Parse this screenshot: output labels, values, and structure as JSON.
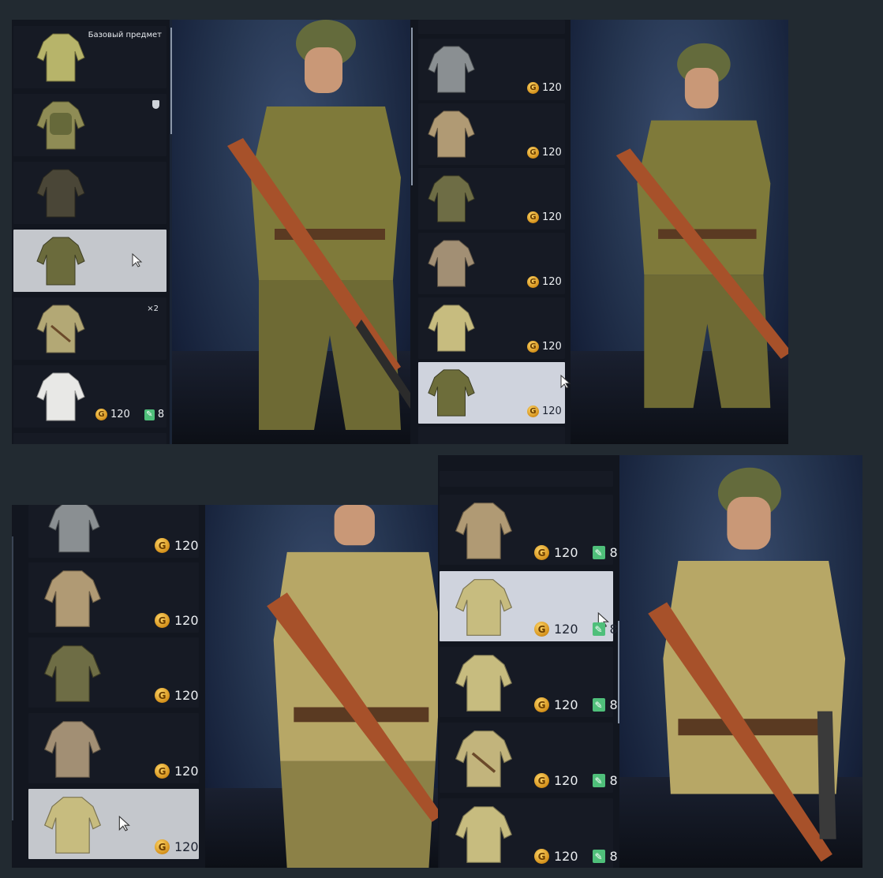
{
  "colors": {
    "jacket_base": "#b7b46a",
    "jacket_olive": "#7a7a3c",
    "jacket_grey": "#8a8f92",
    "jacket_tan": "#b09a74",
    "jacket_white": "#e8e8e6",
    "jacket_khaki": "#c7bc7f",
    "coin": "#e1a326",
    "selected_bg": "#cfd3dd"
  },
  "panel1": {
    "items": [
      {
        "label": "Базовый предмет",
        "jacket": "jacket_base",
        "badge": ""
      },
      {
        "label": "",
        "jacket": "jacket_olive",
        "badge": "shield-icon"
      },
      {
        "label": "",
        "jacket": "jacket_olive",
        "badge": ""
      },
      {
        "label": "",
        "jacket": "jacket_olive",
        "badge": "",
        "selected": true
      },
      {
        "label": "×2",
        "jacket": "jacket_khaki",
        "badge": ""
      },
      {
        "label": "",
        "jacket": "jacket_white",
        "badge": "",
        "price": "120",
        "tickets": "8"
      }
    ]
  },
  "panel2": {
    "items": [
      {
        "jacket": "jacket_grey",
        "price": "120"
      },
      {
        "jacket": "jacket_tan",
        "price": "120"
      },
      {
        "jacket": "jacket_olive",
        "price": "120"
      },
      {
        "jacket": "jacket_tan",
        "price": "120"
      },
      {
        "jacket": "jacket_khaki",
        "price": "120"
      },
      {
        "jacket": "jacket_olive",
        "price": "120",
        "selected": true
      }
    ]
  },
  "panel3": {
    "items": [
      {
        "jacket": "jacket_grey",
        "price": "120"
      },
      {
        "jacket": "jacket_tan",
        "price": "120"
      },
      {
        "jacket": "jacket_olive",
        "price": "120"
      },
      {
        "jacket": "jacket_tan",
        "price": "120"
      },
      {
        "jacket": "jacket_khaki",
        "price": "120",
        "selected": true
      }
    ]
  },
  "panel4": {
    "items": [
      {
        "jacket": "jacket_tan",
        "price": "120",
        "tickets": "8"
      },
      {
        "jacket": "jacket_khaki",
        "price": "120",
        "tickets": "8",
        "selected": true
      },
      {
        "jacket": "jacket_khaki",
        "price": "120",
        "tickets": "8"
      },
      {
        "jacket": "jacket_khaki",
        "price": "120",
        "tickets": "8"
      },
      {
        "jacket": "jacket_khaki",
        "price": "120",
        "tickets": "8"
      }
    ]
  },
  "currency": {
    "coin_symbol": "G",
    "ticket_symbol": "✎"
  }
}
